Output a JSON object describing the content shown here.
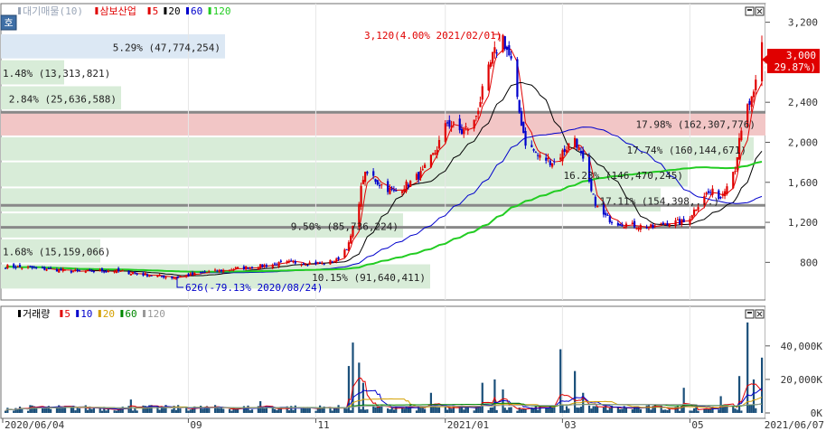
{
  "upper_legend": [
    {
      "label": "대기매물(10)",
      "color": "#9aa6b8"
    },
    {
      "label": "삼보산업",
      "color": "#e00000"
    },
    {
      "label": "5",
      "color": "#e00000"
    },
    {
      "label": "20",
      "color": "#000000"
    },
    {
      "label": "60",
      "color": "#0000cc"
    },
    {
      "label": "120",
      "color": "#22cc22"
    }
  ],
  "lower_legend": [
    {
      "label": "거래량",
      "color": "#000000"
    },
    {
      "label": "5",
      "color": "#e00000"
    },
    {
      "label": "10",
      "color": "#0000cc"
    },
    {
      "label": "20",
      "color": "#d4a000"
    },
    {
      "label": "60",
      "color": "#008800"
    },
    {
      "label": "120",
      "color": "#999999"
    }
  ],
  "side_button": "호",
  "high_annotation": "3,120(4.00% 2021/02/01)",
  "low_annotation": "626(-79.13% 2020/08/24)",
  "current_price_label": {
    "price": "3,000",
    "change": "( 29.87%)"
  },
  "colors": {
    "up": "#e00000",
    "down": "#0000cc",
    "volume": "#1a4f7a",
    "ma5": "#e00000",
    "ma20": "#000000",
    "ma60": "#0000cc",
    "ma120": "#22cc22",
    "band_blue": "#dce8f4",
    "band_green": "#d8ecd8",
    "band_red": "#f2c6c6",
    "level_line": "#888888"
  },
  "chart_data": [
    {
      "type": "candlestick",
      "title": "삼보산업",
      "x_start": "2020/06/04",
      "x_end": "2021/06/07",
      "x_tick_labels": [
        "2020/06/04",
        "09",
        "11",
        "2021/01",
        "03",
        "05"
      ],
      "y_ticks": [
        800,
        1200,
        1600,
        2000,
        2400,
        2800,
        3200
      ],
      "y_tick_labels": [
        "800",
        "1,200",
        "1,600",
        "2,000",
        "2,400",
        "2,800",
        "3,200"
      ],
      "ylim": [
        460,
        3350
      ],
      "price_path": [
        [
          "2020/06/04",
          760
        ],
        [
          "2020/06/20",
          740
        ],
        [
          "2020/07/10",
          705
        ],
        [
          "2020/07/25",
          720
        ],
        [
          "2020/08/10",
          680
        ],
        [
          "2020/08/24",
          650
        ],
        [
          "2020/09/10",
          700
        ],
        [
          "2020/09/25",
          740
        ],
        [
          "2020/10/05",
          760
        ],
        [
          "2020/10/20",
          800
        ],
        [
          "2020/11/05",
          790
        ],
        [
          "2020/11/12",
          820
        ],
        [
          "2020/11/18",
          980
        ],
        [
          "2020/11/22",
          1300
        ],
        [
          "2020/11/25",
          1650
        ],
        [
          "2020/11/28",
          1700
        ],
        [
          "2020/12/02",
          1600
        ],
        [
          "2020/12/10",
          1500
        ],
        [
          "2020/12/18",
          1600
        ],
        [
          "2020/12/24",
          1700
        ],
        [
          "2020/12/30",
          1900
        ],
        [
          "2021/01/05",
          2200
        ],
        [
          "2021/01/12",
          2100
        ],
        [
          "2021/01/18",
          2200
        ],
        [
          "2021/01/22",
          2500
        ],
        [
          "2021/01/27",
          2850
        ],
        [
          "2021/02/01",
          3050
        ],
        [
          "2021/02/05",
          2800
        ],
        [
          "2021/02/08",
          2400
        ],
        [
          "2021/02/12",
          2000
        ],
        [
          "2021/02/19",
          1850
        ],
        [
          "2021/02/26",
          1800
        ],
        [
          "2021/03/04",
          1950
        ],
        [
          "2021/03/08",
          2050
        ],
        [
          "2021/03/12",
          1800
        ],
        [
          "2021/03/16",
          1500
        ],
        [
          "2021/03/20",
          1300
        ],
        [
          "2021/03/27",
          1200
        ],
        [
          "2021/04/05",
          1170
        ],
        [
          "2021/04/15",
          1150
        ],
        [
          "2021/04/22",
          1200
        ],
        [
          "2021/05/01",
          1200
        ],
        [
          "2021/05/06",
          1350
        ],
        [
          "2021/05/10",
          1480
        ],
        [
          "2021/05/14",
          1500
        ],
        [
          "2021/05/18",
          1450
        ],
        [
          "2021/05/21",
          1600
        ],
        [
          "2021/05/25",
          1750
        ],
        [
          "2021/05/27",
          2000
        ],
        [
          "2021/05/31",
          2350
        ],
        [
          "2021/06/03",
          2450
        ],
        [
          "2021/06/07",
          3000
        ]
      ],
      "annotations": [
        {
          "text": "3,120(4.00% 2021/02/01)",
          "x": "2021/02/01",
          "y": 3120
        },
        {
          "text": "626(-79.13% 2020/08/24)",
          "x": "2020/08/24",
          "y": 626
        }
      ],
      "volume_profile": [
        {
          "label": "5.29% (47,774,254)",
          "low": 2820,
          "high": 3080,
          "color": "#dce8f4"
        },
        {
          "label": "1.48% (13,313,821)",
          "low": 2560,
          "high": 2820,
          "color": "#d8ecd8"
        },
        {
          "label": "2.84% (25,636,588)",
          "low": 2310,
          "high": 2560,
          "color": "#d8ecd8"
        },
        {
          "label": "17.98% (162,307,776)",
          "low": 2050,
          "high": 2310,
          "color": "#f2c6c6"
        },
        {
          "label": "17.74% (160,144,671)",
          "low": 1800,
          "high": 2050,
          "color": "#d8ecd8"
        },
        {
          "label": "16.23% (146,470,245)",
          "low": 1540,
          "high": 1800,
          "color": "#d8ecd8"
        },
        {
          "label": "17.11% (154,398,...)",
          "low": 1290,
          "high": 1540,
          "color": "#d8ecd8"
        },
        {
          "label": "9.50% (85,736,224)",
          "low": 1030,
          "high": 1290,
          "color": "#d8ecd8"
        },
        {
          "label": "1.68% (15,159,066)",
          "low": 780,
          "high": 1030,
          "color": "#d8ecd8"
        },
        {
          "label": "10.15% (91,640,411)",
          "low": 520,
          "high": 780,
          "color": "#d8ecd8"
        }
      ],
      "level_lines": [
        2300,
        1370,
        1150
      ],
      "last_price": 3000,
      "last_change_pct": 29.87
    },
    {
      "type": "bar",
      "title": "거래량",
      "y_ticks": [
        0,
        20000,
        40000
      ],
      "y_tick_labels": [
        "0K",
        "20,000K",
        "40,000K"
      ],
      "ylim": [
        0,
        55000
      ],
      "x_end_label": "2021/06/07",
      "volume_spikes": [
        {
          "date": "2020/08/04",
          "value": 8000
        },
        {
          "date": "2020/10/06",
          "value": 7000
        },
        {
          "date": "2020/11/18",
          "value": 28000
        },
        {
          "date": "2020/11/20",
          "value": 42000
        },
        {
          "date": "2020/11/23",
          "value": 30000
        },
        {
          "date": "2020/11/25",
          "value": 18000
        },
        {
          "date": "2020/12/28",
          "value": 12000
        },
        {
          "date": "2021/01/22",
          "value": 18000
        },
        {
          "date": "2021/01/28",
          "value": 20000
        },
        {
          "date": "2021/02/01",
          "value": 14000
        },
        {
          "date": "2021/03/01",
          "value": 38000
        },
        {
          "date": "2021/03/08",
          "value": 25000
        },
        {
          "date": "2021/03/12",
          "value": 12000
        },
        {
          "date": "2021/04/30",
          "value": 15000
        },
        {
          "date": "2021/05/18",
          "value": 10000
        },
        {
          "date": "2021/05/27",
          "value": 22000
        },
        {
          "date": "2021/05/31",
          "value": 54000
        },
        {
          "date": "2021/06/03",
          "value": 20000
        },
        {
          "date": "2021/06/07",
          "value": 33000
        }
      ],
      "volume_baseline": 3000
    }
  ]
}
